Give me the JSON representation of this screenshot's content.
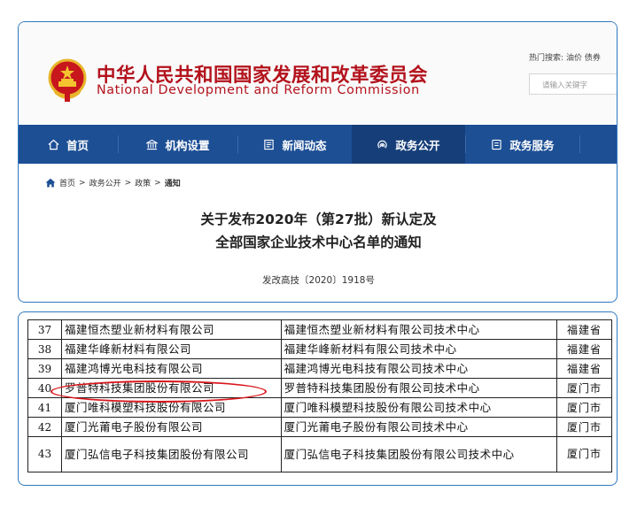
{
  "header": {
    "title_cn": "中华人民共和国国家发展和改革委员会",
    "title_en": "National Development and Reform Commission",
    "hot_label": "热门搜索:",
    "hot_links": "油价  债券",
    "search_placeholder": "请输入关键字",
    "brand_color": "#b3121c"
  },
  "nav": {
    "items": [
      {
        "label": "首页",
        "icon": "home-icon"
      },
      {
        "label": "机构设置",
        "icon": "building-icon"
      },
      {
        "label": "新闻动态",
        "icon": "news-icon"
      },
      {
        "label": "政务公开",
        "icon": "broadcast-icon",
        "active": true
      },
      {
        "label": "政务服务",
        "icon": "service-icon"
      }
    ],
    "bg_color": "#1d4f95"
  },
  "breadcrumb": {
    "items": [
      "首页",
      "政务公开",
      "政策"
    ],
    "separator": ">",
    "current": "通知"
  },
  "document": {
    "title_line1": "关于发布2020年（第27批）新认定及",
    "title_line2": "全部国家企业技术中心名单的通知",
    "doc_number": "发改高技〔2020〕1918号"
  },
  "table": {
    "rows": [
      {
        "no": "37",
        "company": "福建恒杰塑业新材料有限公司",
        "center": "福建恒杰塑业新材料有限公司技术中心",
        "region": "福建省"
      },
      {
        "no": "38",
        "company": "福建华峰新材料有限公司",
        "center": "福建华峰新材料有限公司技术中心",
        "region": "福建省"
      },
      {
        "no": "39",
        "company": "福建鸿博光电科技有限公司",
        "center": "福建鸿博光电科技有限公司技术中心",
        "region": "福建省"
      },
      {
        "no": "40",
        "company": "罗普特科技集团股份有限公司",
        "center": "罗普特科技集团股份有限公司技术中心",
        "region": "厦门市"
      },
      {
        "no": "41",
        "company": "厦门唯科模塑科技股份有限公司",
        "center": "厦门唯科模塑科技股份有限公司技术中心",
        "region": "厦门市"
      },
      {
        "no": "42",
        "company": "厦门光莆电子股份有限公司",
        "center": "厦门光莆电子股份有限公司技术中心",
        "region": "厦门市"
      },
      {
        "no": "43",
        "company": "厦门弘信电子科技集团股份有限公司",
        "center": "厦门弘信电子科技集团股份有限公司技术中心",
        "region": "厦门市"
      }
    ],
    "highlight_row": "40",
    "highlight_color": "#d9161c"
  }
}
